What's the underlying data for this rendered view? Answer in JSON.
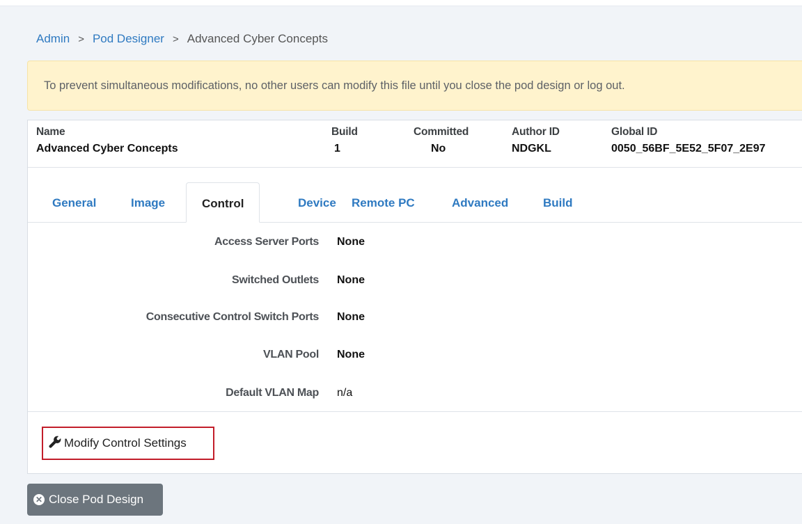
{
  "breadcrumb": {
    "items": [
      "Admin",
      "Pod Designer"
    ],
    "current": "Advanced Cyber Concepts",
    "separator": ">"
  },
  "alert": {
    "text": "To prevent simultaneous modifications, no other users can modify this file until you close the pod design or log out."
  },
  "pod_info": {
    "name_header": "Name",
    "name_value": "Advanced Cyber Concepts",
    "build_header": "Build",
    "build_value": "1",
    "committed_header": "Committed",
    "committed_value": "No",
    "author_header": "Author ID",
    "author_value": "NDGKL",
    "global_header": "Global ID",
    "global_value": "0050_56BF_5E52_5F07_2E97"
  },
  "tabs": [
    "General",
    "Image",
    "Control",
    "Device",
    "Remote PC",
    "Advanced",
    "Build"
  ],
  "active_tab": "Control",
  "control_settings": [
    {
      "label": "Access Server Ports",
      "value": "None"
    },
    {
      "label": "Switched Outlets",
      "value": "None"
    },
    {
      "label": "Consecutive Control Switch Ports",
      "value": "None"
    },
    {
      "label": "VLAN Pool",
      "value": "None"
    },
    {
      "label": "Default VLAN Map",
      "value": "n/a"
    }
  ],
  "buttons": {
    "modify_label": "Modify Control Settings",
    "close_label": "Close Pod Design"
  },
  "colors": {
    "link": "#2f7ac1",
    "alert_bg": "#fff3cd",
    "highlight_border": "#c21d2a",
    "close_btn_bg": "#6c757d"
  }
}
